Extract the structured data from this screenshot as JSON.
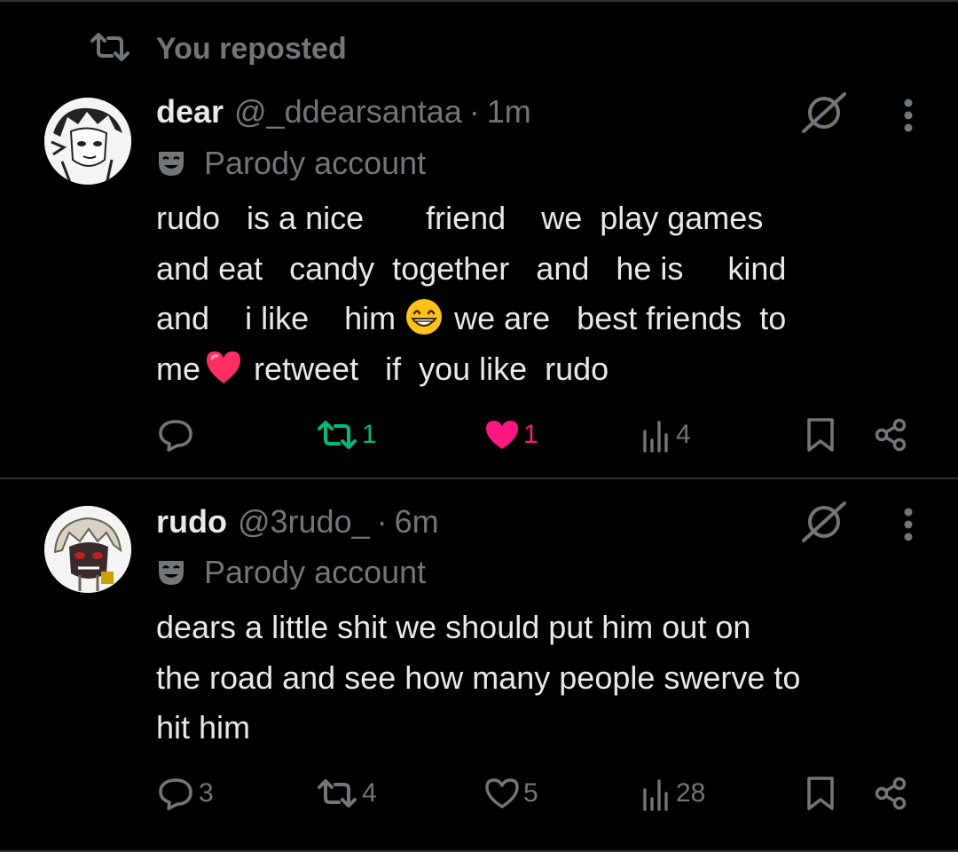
{
  "repost": {
    "label": "You reposted"
  },
  "tweets": [
    {
      "name": "dear",
      "handle": "@_ddearsantaa",
      "dot": "·",
      "time": "1m",
      "parody": "Parody account",
      "lines": [
        [
          "rudo   is a nice       friend    we  play games"
        ],
        [
          "and eat   candy  together   and   he is     kind"
        ],
        [
          "and    i like    him",
          "we are   best friends  to"
        ],
        [
          "me",
          "retweet   if  you like  rudo"
        ]
      ],
      "replies": "",
      "reposts": "1",
      "likes": "1",
      "views": "4",
      "reposted": true,
      "liked": true,
      "repost_color": "#00ba7c",
      "like_color": "#f91880"
    },
    {
      "name": "rudo",
      "handle": "@3rudo_",
      "dot": "·",
      "time": "6m",
      "parody": "Parody account",
      "lines": [
        "dears a little shit we should put him out on",
        "the road and see how many people swerve to",
        "hit him"
      ],
      "replies": "3",
      "reposts": "4",
      "likes": "5",
      "views": "28",
      "reposted": false,
      "liked": false
    }
  ]
}
